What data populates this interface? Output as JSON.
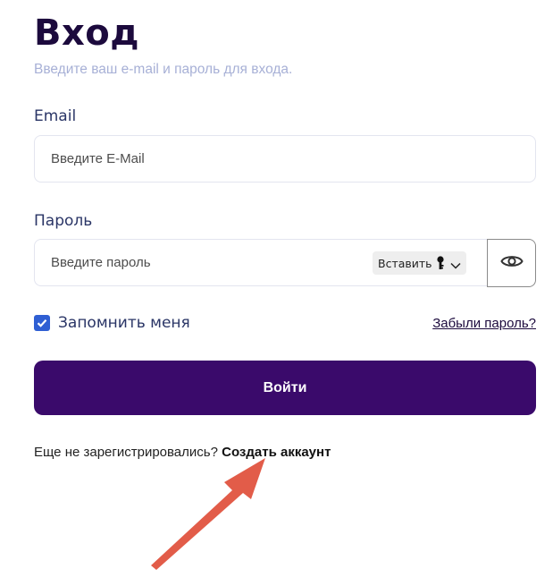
{
  "header": {
    "title": "Вход",
    "subtitle": "Введите ваш e-mail и пароль для входа."
  },
  "email": {
    "label": "Email",
    "placeholder": "Введите E-Mail",
    "value": ""
  },
  "password": {
    "label": "Пароль",
    "placeholder": "Введите пароль",
    "value": "",
    "paste_label": "Вставить",
    "toggle_icon": "eye-icon"
  },
  "remember": {
    "label": "Запомнить меня",
    "checked": true
  },
  "forgot_link": "Забыли пароль?",
  "submit_label": "Войти",
  "register": {
    "prompt": "Еще не зарегистрировались? ",
    "link": "Создать аккаунт"
  },
  "colors": {
    "primary": "#3a0a6b",
    "checkbox": "#2f5fd3",
    "annotation_arrow": "#e0533f"
  }
}
